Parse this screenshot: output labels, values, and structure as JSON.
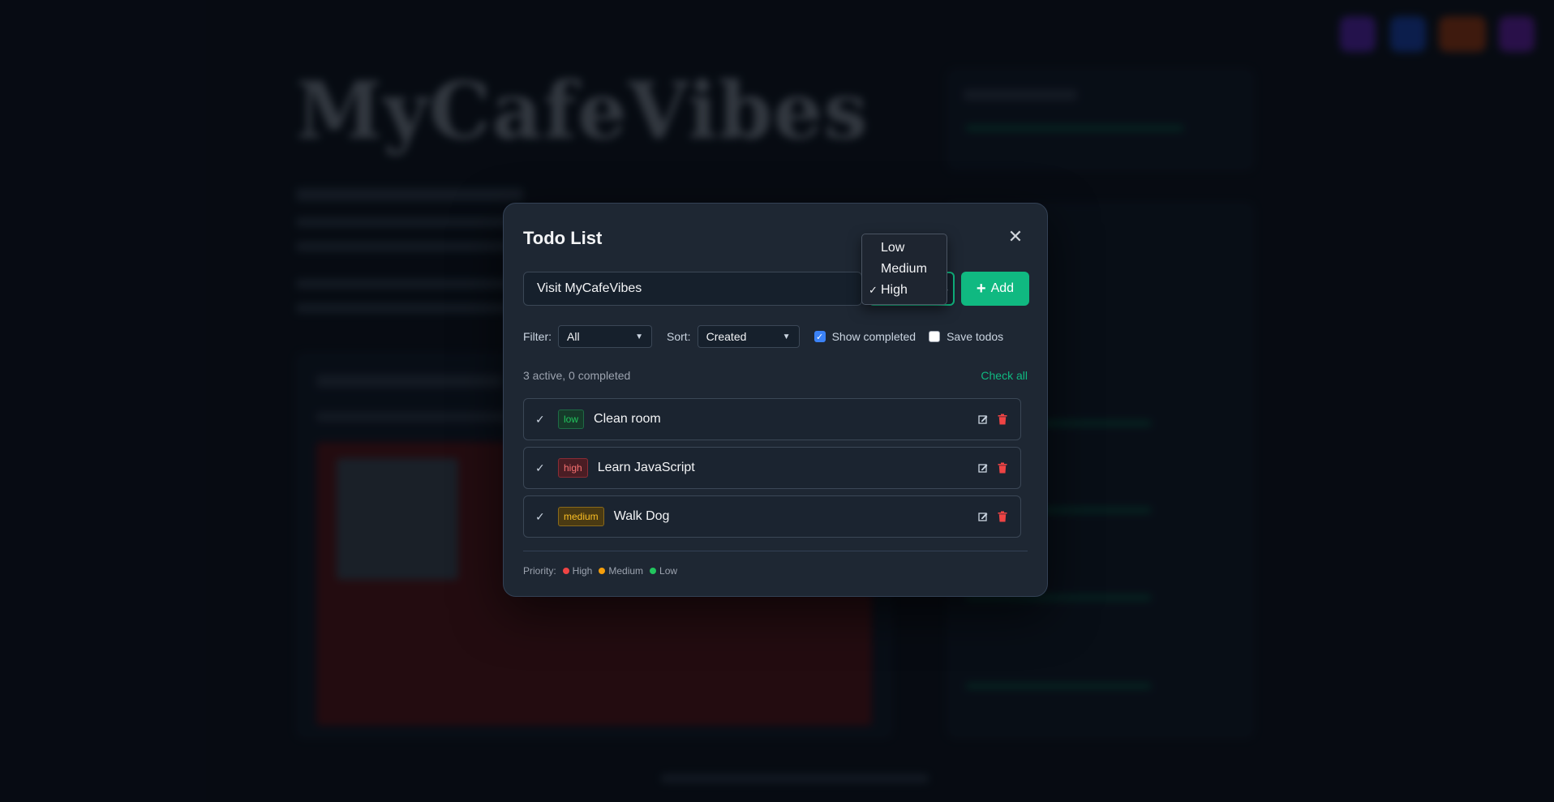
{
  "modal": {
    "title": "Todo List",
    "close_label": "✕",
    "input_value": "Visit MyCafeVibes",
    "add_label": "Add",
    "filter": {
      "label": "Filter:",
      "value": "All"
    },
    "sort": {
      "label": "Sort:",
      "value": "Created"
    },
    "show_completed": {
      "label": "Show completed",
      "checked": true
    },
    "save_todos": {
      "label": "Save todos",
      "checked": false
    },
    "summary": "3 active, 0 completed",
    "check_all_label": "Check all",
    "todos": [
      {
        "priority": "low",
        "text": "Clean room"
      },
      {
        "priority": "high",
        "text": "Learn JavaScript"
      },
      {
        "priority": "medium",
        "text": "Walk Dog"
      }
    ],
    "legend": {
      "label": "Priority:",
      "items": [
        {
          "label": "High",
          "color": "#ef4444"
        },
        {
          "label": "Medium",
          "color": "#f59e0b"
        },
        {
          "label": "Low",
          "color": "#22c55e"
        }
      ]
    }
  },
  "priority_dropdown": {
    "options": [
      "Low",
      "Medium",
      "High"
    ],
    "selected": "High"
  },
  "background": {
    "title": "MyCafeVibes"
  },
  "colors": {
    "accent": "#10b981",
    "modal_bg": "#1e2733",
    "page_bg": "#0b1019"
  }
}
